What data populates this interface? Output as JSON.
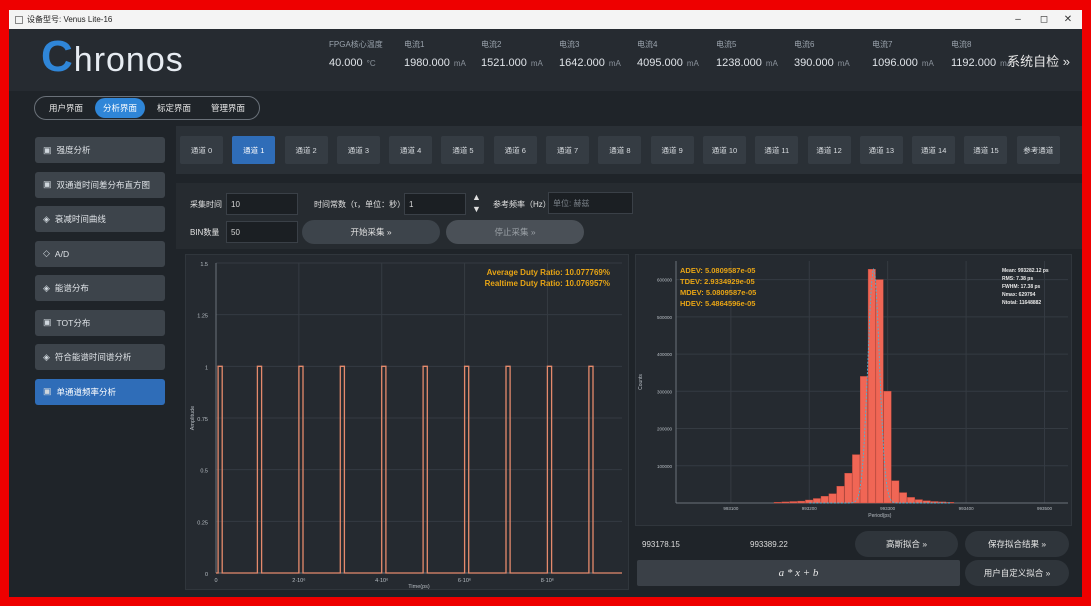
{
  "window": {
    "title": "设备型号: Venus Lite-16",
    "min": "–",
    "max": "◻",
    "close": "✕"
  },
  "app": {
    "logo_c": "C",
    "logo_rest": "hronos",
    "self_check": "系统自检 »"
  },
  "meters": [
    {
      "label": "FPGA核心温度",
      "value": "40.000",
      "unit": "°C"
    },
    {
      "label": "电流1",
      "value": "1980.000",
      "unit": "mA"
    },
    {
      "label": "电流2",
      "value": "1521.000",
      "unit": "mA"
    },
    {
      "label": "电流3",
      "value": "1642.000",
      "unit": "mA"
    },
    {
      "label": "电流4",
      "value": "4095.000",
      "unit": "mA"
    },
    {
      "label": "电流5",
      "value": "1238.000",
      "unit": "mA"
    },
    {
      "label": "电流6",
      "value": "390.000",
      "unit": "mA"
    },
    {
      "label": "电流7",
      "value": "1096.000",
      "unit": "mA"
    },
    {
      "label": "电流8",
      "value": "1192.000",
      "unit": "mA"
    }
  ],
  "nav": {
    "tabs": [
      "用户界面",
      "分析界面",
      "标定界面",
      "管理界面"
    ],
    "active": 1
  },
  "sidebar": {
    "items": [
      {
        "icon": "▣",
        "label": "强度分析"
      },
      {
        "icon": "▣",
        "label": "双通道时间差分布直方图"
      },
      {
        "icon": "◈",
        "label": "衰减时间曲线"
      },
      {
        "icon": "◇",
        "label": "A/D"
      },
      {
        "icon": "◈",
        "label": "能谱分布"
      },
      {
        "icon": "▣",
        "label": "TOT分布"
      },
      {
        "icon": "◈",
        "label": "符合能谱时间谱分析"
      },
      {
        "icon": "▣",
        "label": "单通道频率分析"
      }
    ],
    "active": 7
  },
  "channels": {
    "labels": [
      "通道 0",
      "通道 1",
      "通道 2",
      "通道 3",
      "通道 4",
      "通道 5",
      "通道 6",
      "通道 7",
      "通道 8",
      "通道 9",
      "通道 10",
      "通道 11",
      "通道 12",
      "通道 13",
      "通道 14",
      "通道 15",
      "参考通道"
    ],
    "active": 1
  },
  "controls": {
    "sample_time_label": "采集时间",
    "sample_time_value": "10",
    "time_const_label": "时间常数（τ，单位：秒）",
    "time_const_value": "1",
    "ref_freq_label": "参考频率（Hz）",
    "ref_freq_placeholder": "单位: 赫兹",
    "bin_label": "BIN数量",
    "bin_value": "50",
    "start_btn": "开始采集 »",
    "stop_btn": "停止采集 »"
  },
  "left_chart": {
    "annot1": "Average Duty Ratio: 10.077769%",
    "annot2": "Realtime Duty Ratio: 10.076957%",
    "ylabel": "Amplitude",
    "xlabel": "Time(ps)",
    "yticks": [
      "1.5",
      "1.25",
      "1",
      "0.75",
      "0.5",
      "0.25",
      "0"
    ],
    "xticks": [
      "0",
      "2·10⁶",
      "4·10⁶",
      "6·10⁶",
      "8·10⁶"
    ]
  },
  "right_chart": {
    "adev": "ADEV: 5.0809587e-05",
    "tdev": "TDEV: 2.9334929e-05",
    "mdev": "MDEV: 5.0809587e-05",
    "hdev": "HDEV: 5.4864596e-05",
    "stats": [
      "Mean: 993282.12 ps",
      "RMS: 7.38 ps",
      "FWHM: 17.38 ps",
      "Nmax: 629794",
      "Ntotal: 11648882"
    ],
    "ylabel": "Counts",
    "xlabel": "Period(ps)",
    "yticks": [
      "600000",
      "500000",
      "400000",
      "300000",
      "200000",
      "100000"
    ],
    "xticks": [
      "993100",
      "993200",
      "993300",
      "993400",
      "993500"
    ]
  },
  "fit": {
    "min_value": "993178.15",
    "max_value": "993389.22",
    "gauss_btn": "高斯拟合 »",
    "save_btn": "保存拟合结果 »",
    "formula": "a * x + b",
    "custom_btn": "用户自定义拟合 »"
  },
  "chart_data": [
    {
      "type": "line",
      "title": "",
      "xlabel": "Time(ps)",
      "ylabel": "Amplitude",
      "ylim": [
        0,
        1.5
      ],
      "xlim": [
        0,
        9800000
      ],
      "x": [
        0,
        50000,
        50000,
        150000,
        150000,
        1000000,
        1000000,
        1100000,
        1100000,
        2000000,
        2000000,
        2100000,
        2100000,
        3000000,
        3000000,
        3100000,
        3100000,
        4000000,
        4000000,
        4100000,
        4100000,
        5000000,
        5000000,
        5100000,
        5100000,
        6000000,
        6000000,
        6100000,
        6100000,
        7000000,
        7000000,
        7100000,
        7100000,
        8000000,
        8000000,
        8100000,
        8100000,
        9000000,
        9000000,
        9100000,
        9100000,
        9800000
      ],
      "y": [
        0,
        0,
        1,
        1,
        0,
        0,
        1,
        1,
        0,
        0,
        1,
        1,
        0,
        0,
        1,
        1,
        0,
        0,
        1,
        1,
        0,
        0,
        1,
        1,
        0,
        0,
        1,
        1,
        0,
        0,
        1,
        1,
        0,
        0,
        1,
        1,
        0,
        0,
        1,
        1,
        0,
        0
      ],
      "legend": "none",
      "grid": true
    },
    {
      "type": "bar",
      "title": "",
      "xlabel": "Period(ps)",
      "ylabel": "Counts",
      "ylim": [
        0,
        650000
      ],
      "xlim": [
        993030,
        993530
      ],
      "bin_centers": [
        993160,
        993170,
        993180,
        993190,
        993200,
        993210,
        993220,
        993230,
        993240,
        993250,
        993260,
        993270,
        993280,
        993290,
        993300,
        993310,
        993320,
        993330,
        993340,
        993350,
        993360,
        993370,
        993380
      ],
      "values": [
        2000,
        3000,
        4000,
        5000,
        8000,
        12000,
        18000,
        25000,
        45000,
        80000,
        130000,
        340000,
        628000,
        600000,
        300000,
        60000,
        28000,
        15000,
        9000,
        6000,
        4000,
        3000,
        2000
      ],
      "fit": "gaussian",
      "grid": true
    }
  ]
}
